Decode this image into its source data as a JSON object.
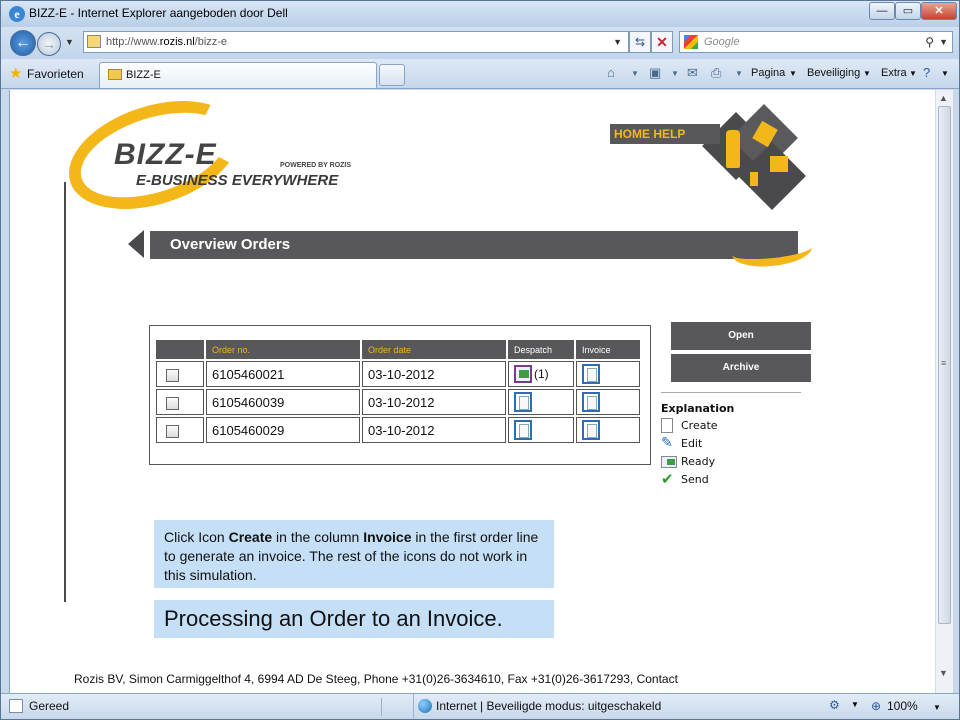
{
  "window": {
    "title": "BIZZ-E - Internet Explorer aangeboden door Dell",
    "min_label": "—",
    "max_label": "▭",
    "close_label": "✕"
  },
  "addressbar": {
    "url_prefix": "http://www.",
    "url_domain": "rozis.nl",
    "url_path": "/bizz-e",
    "search_placeholder": "Google"
  },
  "tabs": {
    "favorites_label": "Favorieten",
    "active_tab_label": "BIZZ-E"
  },
  "commandbar": {
    "pagina": "Pagina",
    "beveiliging": "Beveiliging",
    "extra": "Extra"
  },
  "page": {
    "logo_brand": "BIZZ-E",
    "logo_powered": "POWERED BY ROZIS",
    "logo_tagline": "E-BUSINESS EVERYWHERE",
    "home_help": "HOME HELP",
    "banner_title": "Overview Orders",
    "table": {
      "headers": [
        "",
        "Order no.",
        "Order date",
        "Despatch",
        "Invoice"
      ],
      "rows": [
        {
          "order_no": "6105460021",
          "order_date": "03-10-2012",
          "despatch_count": "(1)"
        },
        {
          "order_no": "6105460039",
          "order_date": "03-10-2012",
          "despatch_count": ""
        },
        {
          "order_no": "6105460029",
          "order_date": "03-10-2012",
          "despatch_count": ""
        }
      ]
    },
    "buttons": {
      "open": "Open",
      "archive": "Archive"
    },
    "explanation": {
      "title": "Explanation",
      "items": [
        "Create",
        "Edit",
        "Ready",
        "Send"
      ]
    },
    "instruction": {
      "p1": "Click Icon ",
      "b1": "Create",
      "p2": " in the column ",
      "b2": "Invoice",
      "p3": " in the first order line to generate an invoice. The rest of the icons do not work in this simulation."
    },
    "caption": "Processing an Order to an Invoice.",
    "footer": "Rozis BV, Simon Carmiggelthof 4, 6994 AD De Steeg, Phone +31(0)26-3634610, Fax +31(0)26-3617293, Contact"
  },
  "statusbar": {
    "status": "Gereed",
    "zone": "Internet | Beveiligde modus: uitgeschakeld",
    "zoom": "100%"
  },
  "colors": {
    "brand_yellow": "#f3b71a",
    "brand_gray": "#58585a",
    "note_blue": "#c5dff7"
  }
}
